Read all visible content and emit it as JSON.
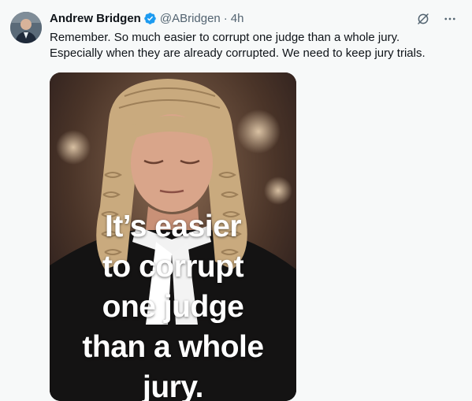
{
  "tweet": {
    "author_name": "Andrew Bridgen",
    "handle": "@ABridgen",
    "separator": "·",
    "time": "4h",
    "text_lines": [
      "Remember. So much easier to corrupt one judge than a whole jury.",
      "Especially when they are already corrupted. We need to keep jury trials."
    ],
    "media_caption_lines": [
      "It’s easier",
      "to corrupt",
      "one judge",
      "than a whole",
      "jury."
    ]
  },
  "icons": {
    "verified": "verified-badge-icon",
    "grok": "grok-icon",
    "more": "more-options-icon"
  },
  "colors": {
    "verified_blue": "#1d9bf0",
    "secondary_text": "#536471",
    "background": "#f7f9f9"
  }
}
